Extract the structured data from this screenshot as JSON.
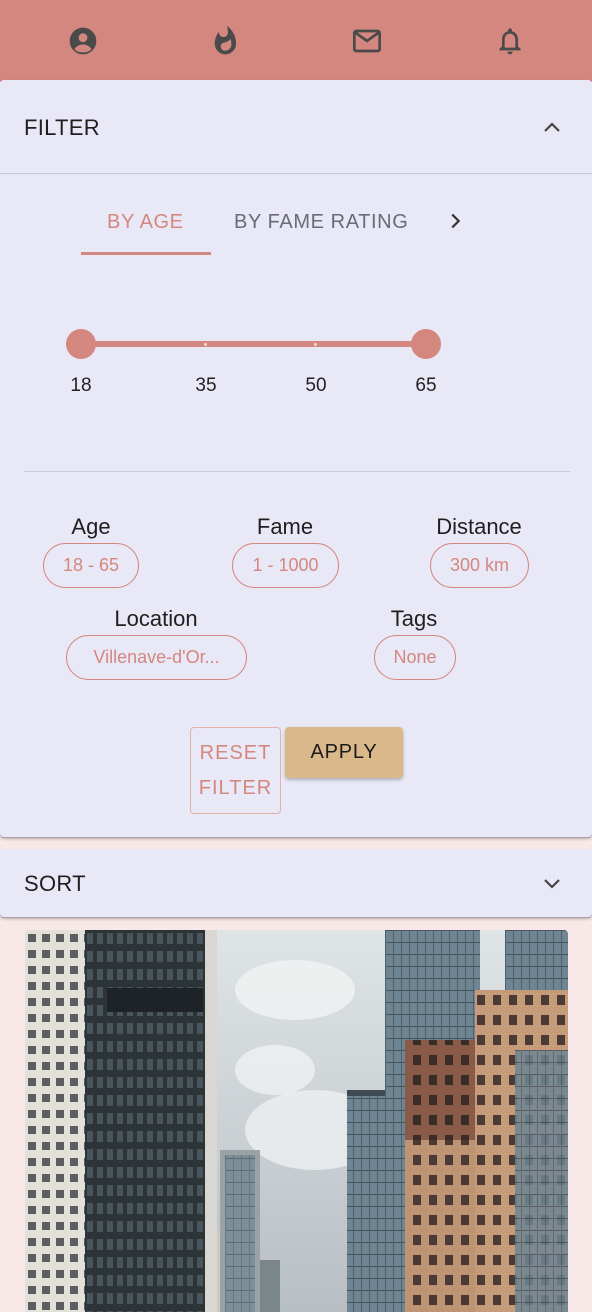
{
  "nav": {
    "items": [
      {
        "name": "profile-icon"
      },
      {
        "name": "flame-icon"
      },
      {
        "name": "mail-icon"
      },
      {
        "name": "bell-icon"
      }
    ]
  },
  "filter": {
    "title": "FILTER",
    "tabs": [
      "BY AGE",
      "BY FAME RATING"
    ],
    "active_tab": "BY AGE",
    "slider": {
      "min": 18,
      "max": 65,
      "value": [
        18,
        65
      ],
      "labels": [
        "18",
        "35",
        "50",
        "65"
      ]
    },
    "summary": {
      "age_label": "Age",
      "age_value": "18 - 65",
      "fame_label": "Fame",
      "fame_value": "1 - 1000",
      "distance_label": "Distance",
      "distance_value": "300 km",
      "location_label": "Location",
      "location_value": "Villenave-d'Or...",
      "tags_label": "Tags",
      "tags_value": "None"
    },
    "reset_line1": "RESET",
    "reset_line2": "FILTER",
    "apply_label": "APPLY"
  },
  "sort": {
    "title": "SORT"
  },
  "colors": {
    "accent": "#d4877e",
    "panel": "#e9e8f6",
    "page": "#f8e9e8",
    "apply": "#d9b98a"
  }
}
